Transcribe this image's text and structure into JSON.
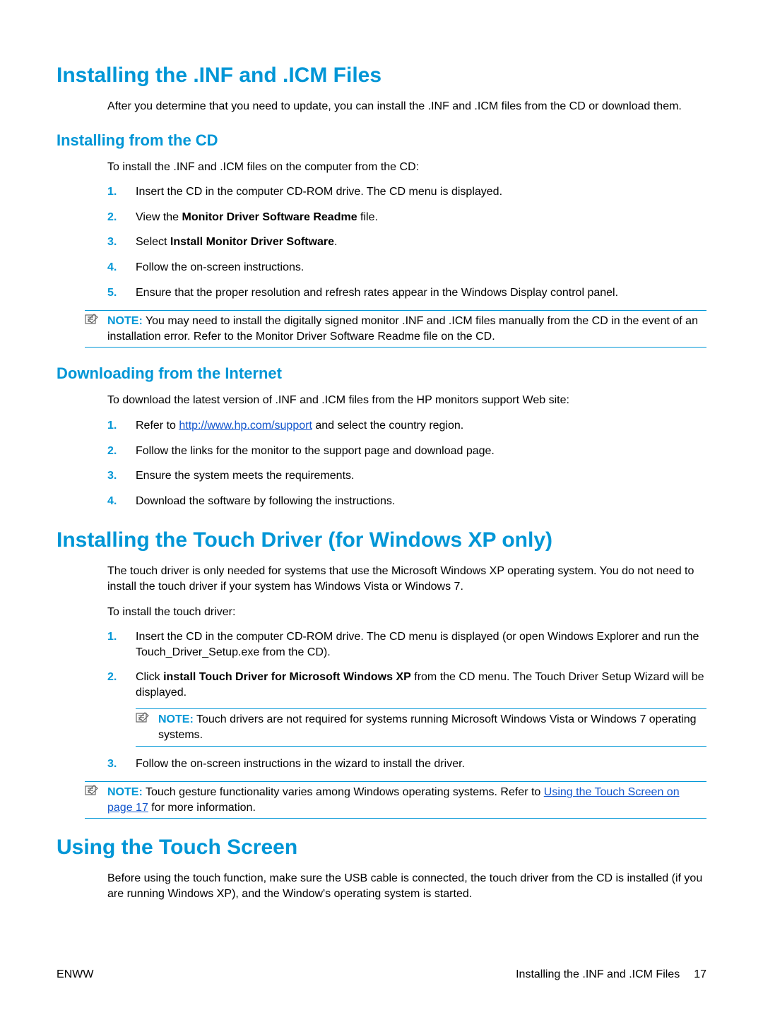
{
  "section1": {
    "title": "Installing the .INF and .ICM Files",
    "intro": "After you determine that you need to update, you can install the .INF and .ICM files from the CD or download them.",
    "sub1": {
      "title": "Installing from the CD",
      "intro": "To install the .INF and .ICM files on the computer from the CD:",
      "steps": {
        "s1": "Insert the CD in the computer CD-ROM drive. The CD menu is displayed.",
        "s2_a": "View the ",
        "s2_b": "Monitor Driver Software Readme",
        "s2_c": " file.",
        "s3_a": "Select ",
        "s3_b": "Install Monitor Driver Software",
        "s3_c": ".",
        "s4": "Follow the on-screen instructions.",
        "s5": "Ensure that the proper resolution and refresh rates appear in the Windows Display control panel."
      },
      "note": {
        "label": "NOTE:",
        "text": "   You may need to install the digitally signed monitor .INF and .ICM files manually from the CD in the event of an installation error. Refer to the Monitor Driver Software Readme file on the CD."
      }
    },
    "sub2": {
      "title": "Downloading from the Internet",
      "intro": "To download the latest version of .INF and .ICM files from the HP monitors support Web site:",
      "steps": {
        "s1_a": "Refer to ",
        "s1_link": "http://www.hp.com/support",
        "s1_c": " and select the country region.",
        "s2": "Follow the links for the monitor to the support page and download page.",
        "s3": "Ensure the system meets the requirements.",
        "s4": "Download the software by following the instructions."
      }
    }
  },
  "section2": {
    "title": "Installing the Touch Driver (for Windows XP only)",
    "p1": "The touch driver is only needed for systems that use the Microsoft Windows XP operating system. You do not need to install the touch driver if your system has Windows Vista or Windows 7.",
    "p2": "To install the touch driver:",
    "steps": {
      "s1": "Insert the CD in the computer CD-ROM drive. The CD menu is displayed (or open Windows Explorer and run the Touch_Driver_Setup.exe from the CD).",
      "s2_a": "Click ",
      "s2_b": "install Touch Driver for Microsoft Windows XP",
      "s2_c": " from the CD menu. The Touch Driver Setup Wizard will be displayed.",
      "s3": "Follow the on-screen instructions in the wizard to install the driver."
    },
    "note_inner": {
      "label": "NOTE:",
      "text": "   Touch drivers are not required for systems running Microsoft Windows Vista or Windows 7 operating systems."
    },
    "note_outer": {
      "label": "NOTE:",
      "text_a": "   Touch gesture functionality varies among Windows operating systems. Refer to ",
      "link": "Using the Touch Screen on page 17",
      "text_b": " for more information."
    }
  },
  "section3": {
    "title": "Using the Touch Screen",
    "p1": "Before using the touch function, make sure the USB cable is connected, the touch driver from the CD is installed (if you are running Windows XP), and the Window's operating system is started."
  },
  "footer": {
    "left": "ENWW",
    "right_text": "Installing the .INF and .ICM Files",
    "page": "17"
  },
  "list_numbers": {
    "n1": "1.",
    "n2": "2.",
    "n3": "3.",
    "n4": "4.",
    "n5": "5."
  }
}
